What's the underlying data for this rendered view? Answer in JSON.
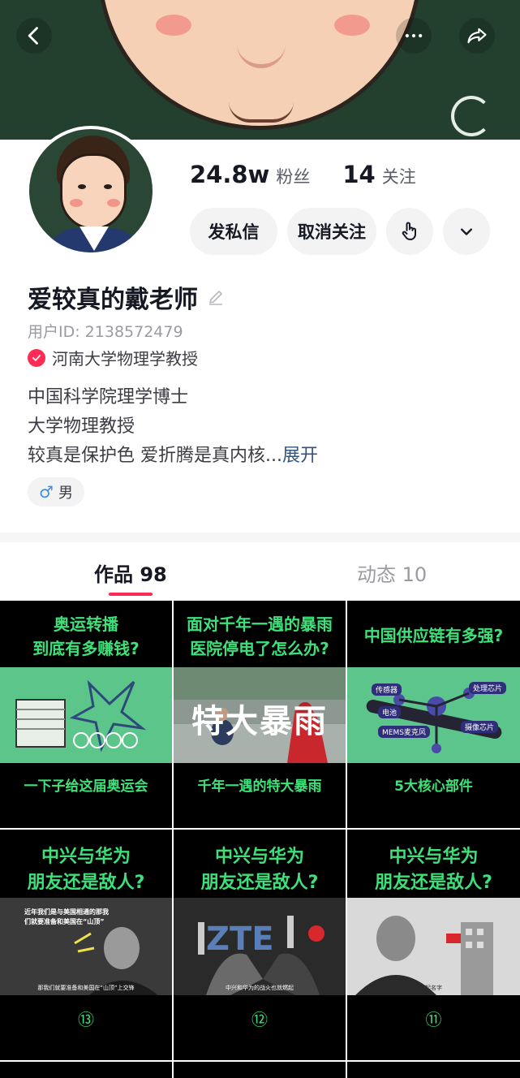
{
  "header": {
    "back_icon": "chevron-left-icon",
    "more_icon": "more-dots-icon",
    "share_icon": "share-arrow-icon"
  },
  "profile": {
    "followers_count": "24.8w",
    "followers_label": "粉丝",
    "following_count": "14",
    "following_label": "关注",
    "message_label": "发私信",
    "unfollow_label": "取消关注",
    "name": "爱较真的戴老师",
    "user_id": "用户ID: 2138572479",
    "verification": "河南大学物理学教授",
    "bio_line1": "中国科学院理学博士",
    "bio_line2": "大学物理教授",
    "bio_line3": "较真是保护色  爱折腾是真内核...",
    "expand_label": "展开",
    "gender_symbol": "♂",
    "gender": "男"
  },
  "tabs": [
    {
      "label": "作品 98"
    },
    {
      "label": "动态 10"
    }
  ],
  "videos": [
    {
      "title": "奥运转播\n到底有多赚钱?",
      "caption": "一下子给这届奥运会"
    },
    {
      "title": "面对千年一遇的暴雨\n医院停电了怎么办?",
      "caption": "千年一遇的特大暴雨",
      "overlay": "特大暴雨"
    },
    {
      "title": "中国供应链有多强?",
      "caption": "5大核心部件",
      "labels": [
        "传感器",
        "处理芯片",
        "摄像芯片",
        "MEMS麦克风",
        "电池"
      ]
    },
    {
      "title": "中兴与华为\n朋友还是敌人?",
      "episode": "⑬",
      "quote": "近年我们是与美国相通的那我们就要准备和美国在“山顶”",
      "subtitle": "那我们就要准备和美国在“山顶”上交锋"
    },
    {
      "title": "中兴与华为\n朋友还是敌人?",
      "episode": "⑫",
      "overlay": "ZTE",
      "subtitle": "中兴和华为的战火也就燃起"
    },
    {
      "title": "中兴与华为\n朋友还是敌人?",
      "episode": "⑪",
      "subtitle": "起名字"
    }
  ],
  "colors": {
    "accent": "#fe2c55",
    "caption_green": "#3ee07a",
    "cover_green": "#23402f"
  }
}
